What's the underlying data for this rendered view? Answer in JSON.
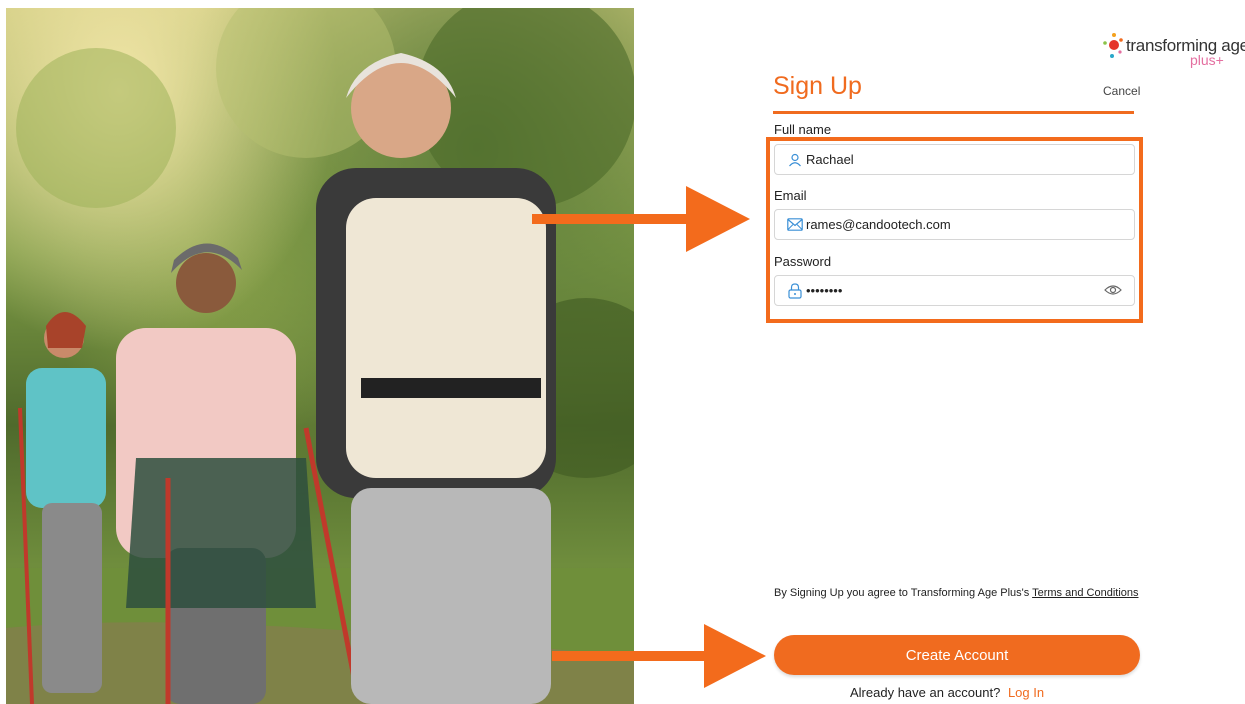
{
  "logo": {
    "name": "transforming age",
    "suffix": "plus+"
  },
  "header": {
    "title": "Sign Up",
    "cancel_label": "Cancel"
  },
  "form": {
    "full_name": {
      "label": "Full name",
      "value": "Rachael",
      "icon": "user-icon"
    },
    "email": {
      "label": "Email",
      "value": "rames@candootech.com",
      "icon": "envelope-icon"
    },
    "password": {
      "label": "Password",
      "value": "••••••••",
      "icon": "lock-icon",
      "toggle_icon": "eye-icon"
    }
  },
  "terms": {
    "text": "By Signing Up you agree to Transforming Age Plus's",
    "link_label": "Terms and Conditions"
  },
  "actions": {
    "create_label": "Create Account",
    "login_prompt": "Already have an account?",
    "login_link": "Log In"
  },
  "colors": {
    "accent": "#f06b1f",
    "arrow": "#f36b1c",
    "highlight": "#f36b1c"
  }
}
